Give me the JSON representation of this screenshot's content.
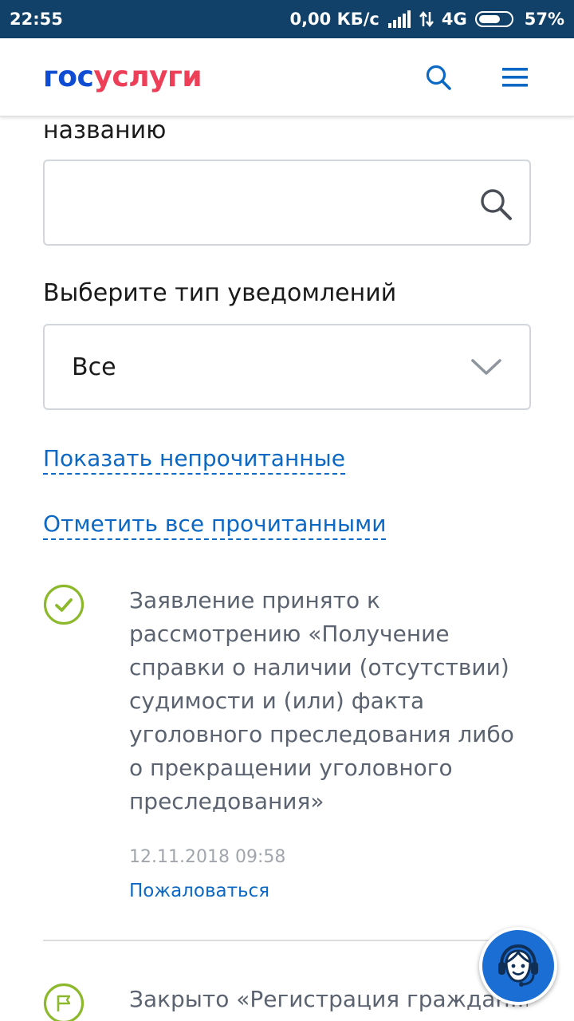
{
  "statusbar": {
    "time": "22:55",
    "speed": "0,00 КБ/с",
    "network": "4G",
    "battery": "57%"
  },
  "header": {
    "logo_part1": "гос",
    "logo_part2": "услуги",
    "search_icon": "search-icon",
    "menu_icon": "hamburger-menu-icon"
  },
  "filters": {
    "cut_label": "названию",
    "search": {
      "value": "",
      "placeholder": ""
    },
    "type_label": "Выберите тип уведомлений",
    "type_selected": "Все"
  },
  "links": {
    "show_unread": "Показать непрочитанные",
    "mark_all_read": "Отметить все прочитанными"
  },
  "notifications": [
    {
      "icon": "check-circle-icon",
      "text": "Заявление принято к рассмотрению «Получение справки о наличии (отсутствии) судимости и (или) факта уголовного преследования либо о прекращении уголовного преследования»",
      "date": "12.11.2018 09:58",
      "action": "Пожаловаться"
    },
    {
      "icon": "flag-circle-icon",
      "text": "Закрыто «Регистрация граждан..."
    }
  ],
  "colors": {
    "statusbar": "#114068",
    "brand_blue": "#0d4cd3",
    "brand_red": "#ee3f58",
    "link": "#0b68c4",
    "success_green": "#8cb82b",
    "support_button": "#1b6ed4"
  },
  "support": {
    "icon": "support-operator-icon"
  }
}
